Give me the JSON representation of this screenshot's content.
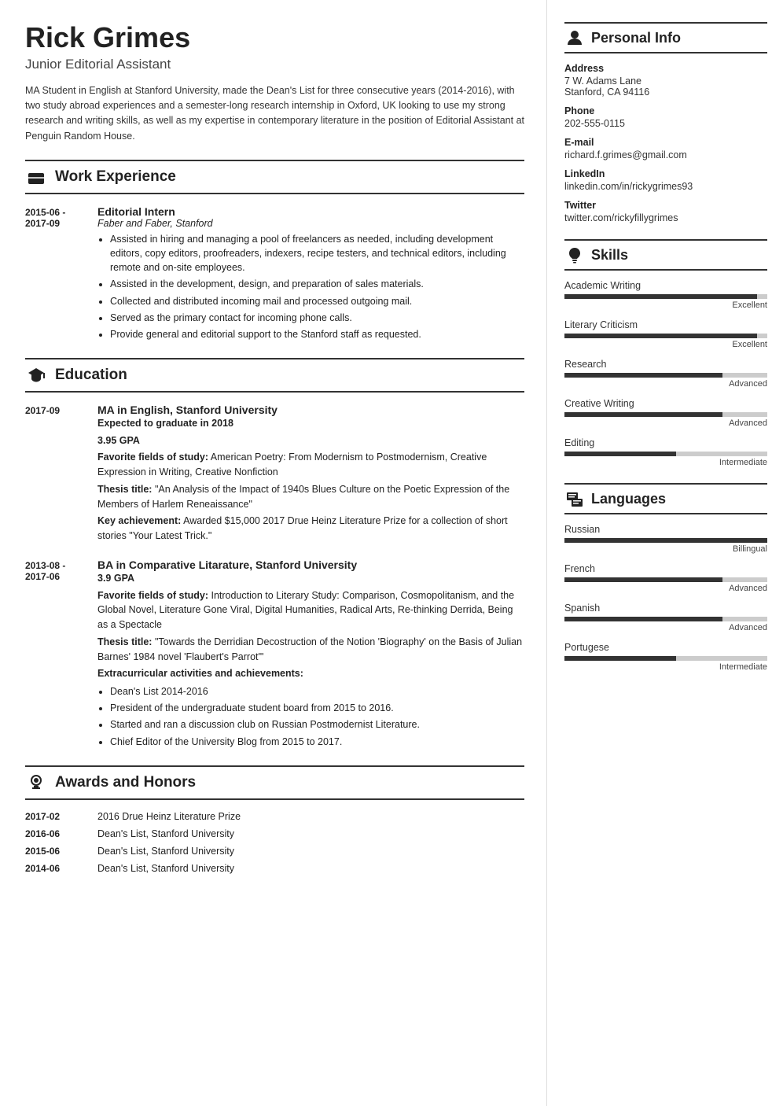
{
  "person": {
    "name": "Rick Grimes",
    "title": "Junior Editorial Assistant",
    "summary": "MA Student in English at Stanford University, made the Dean's List for three consecutive years (2014-2016), with two study abroad experiences and a semester-long research internship in Oxford, UK looking to use my strong research and writing skills, as well as my expertise in contemporary literature in the position of Editorial Assistant at Penguin Random House."
  },
  "sections": {
    "work_experience": {
      "label": "Work Experience",
      "entries": [
        {
          "date": "2015-06 -\n2017-09",
          "title": "Editorial Intern",
          "subtitle": "Faber and Faber, Stanford",
          "bullets": [
            "Assisted in hiring and managing a pool of freelancers as needed, including development editors, copy editors, proofreaders, indexers, recipe testers, and technical editors, including remote and on-site employees.",
            "Assisted in the development, design, and preparation of sales materials.",
            "Collected and distributed incoming mail and processed outgoing mail.",
            "Served as the primary contact for incoming phone calls.",
            "Provide general and editorial support to the Stanford staff as requested."
          ]
        }
      ]
    },
    "education": {
      "label": "Education",
      "entries": [
        {
          "date": "2017-09",
          "title": "MA in English, Stanford University",
          "lines": [
            {
              "bold": true,
              "text": "Expected to graduate in 2018"
            },
            {
              "bold": true,
              "text": "3.95 GPA"
            },
            {
              "bold": "Favorite fields of study:",
              "rest": " American Poetry: From Modernism to Postmodernism, Creative Expression in Writing, Creative Nonfiction"
            },
            {
              "bold": "Thesis title:",
              "rest": " \"An Analysis of the Impact of 1940s Blues Culture on the Poetic Expression of the Members of Harlem Reneaissance\""
            },
            {
              "bold": "Key achievement:",
              "rest": " Awarded $15,000 2017 Drue Heinz Literature Prize for a collection of short stories \"Your Latest Trick.\""
            }
          ]
        },
        {
          "date": "2013-08 -\n2017-06",
          "title": "BA in Comparative Litarature, Stanford University",
          "lines": [
            {
              "bold": true,
              "text": "3.9 GPA"
            },
            {
              "bold": "Favorite fields of study:",
              "rest": " Introduction to Literary Study: Comparison, Cosmopolitanism, and the Global Novel, Literature Gone Viral, Digital Humanities, Radical Arts, Re-thinking Derrida, Being as a Spectacle"
            },
            {
              "bold": "Thesis title:",
              "rest": " \"Towards the Derridian Decostruction of the Notion 'Biography' on the Basis of Julian Barnes' 1984 novel 'Flaubert's Parrot'\""
            },
            {
              "bold": "Extracurricular activities and achievements:",
              "rest": ""
            }
          ],
          "bullets": [
            "Dean's List 2014-2016",
            "President of the undergraduate student board from 2015 to 2016.",
            "Started and ran a discussion club on Russian Postmodernist Literature.",
            "Chief Editor of the University Blog from 2015 to 2017."
          ]
        }
      ]
    },
    "awards": {
      "label": "Awards and Honors",
      "entries": [
        {
          "date": "2017-02",
          "text": "2016 Drue Heinz Literature Prize"
        },
        {
          "date": "2016-06",
          "text": "Dean's List, Stanford University"
        },
        {
          "date": "2015-06",
          "text": "Dean's List, Stanford University"
        },
        {
          "date": "2014-06",
          "text": "Dean's List, Stanford University"
        }
      ]
    }
  },
  "personal_info": {
    "label": "Personal Info",
    "fields": [
      {
        "label": "Address",
        "value": "7 W. Adams Lane\nStanford, CA 94116"
      },
      {
        "label": "Phone",
        "value": "202-555-0115"
      },
      {
        "label": "E-mail",
        "value": "richard.f.grimes@gmail.com"
      },
      {
        "label": "LinkedIn",
        "value": "linkedin.com/in/rickygrimes93"
      },
      {
        "label": "Twitter",
        "value": "twitter.com/rickyfillygrimes"
      }
    ]
  },
  "skills": {
    "label": "Skills",
    "items": [
      {
        "name": "Academic Writing",
        "level": "Excellent",
        "pct": 95
      },
      {
        "name": "Literary Criticism",
        "level": "Excellent",
        "pct": 95
      },
      {
        "name": "Research",
        "level": "Advanced",
        "pct": 78
      },
      {
        "name": "Creative Writing",
        "level": "Advanced",
        "pct": 78
      },
      {
        "name": "Editing",
        "level": "Intermediate",
        "pct": 55
      }
    ]
  },
  "languages": {
    "label": "Languages",
    "items": [
      {
        "name": "Russian",
        "level": "Billingual",
        "pct": 100
      },
      {
        "name": "French",
        "level": "Advanced",
        "pct": 78
      },
      {
        "name": "Spanish",
        "level": "Advanced",
        "pct": 78
      },
      {
        "name": "Portugese",
        "level": "Intermediate",
        "pct": 55
      }
    ]
  }
}
